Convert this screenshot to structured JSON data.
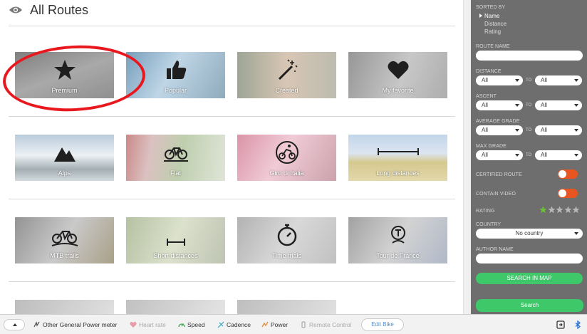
{
  "header": {
    "title": "All Routes"
  },
  "tiles": {
    "premium": "Premium",
    "popular": "Popular",
    "created": "Created",
    "favorite": "My favorite",
    "alps": "Alps",
    "flat": "Flat",
    "giro": "Giro di Italia",
    "long": "Long distances",
    "mtb": "MTB trails",
    "short": "Short distances",
    "time": "Time trials",
    "tdf": "Tour de France"
  },
  "sidebar": {
    "sorted_by": "SORTED BY",
    "sort_options": [
      "Name",
      "Distance",
      "Rating"
    ],
    "route_name": "ROUTE NAME",
    "distance": "DISTANCE",
    "ascent": "ASCENT",
    "average_grade": "AVERAGE GRADE",
    "max_grade": "MAX GRADE",
    "to": "TO",
    "all": "All",
    "certified_route": "CERTIFIED ROUTE",
    "contain_video": "CONTAIN VIDEO",
    "rating": "RATING",
    "rating_value": 1,
    "country": "COUNTRY",
    "country_value": "No country",
    "author_name": "AUTHOR NAME",
    "search_in_map": "SEARCH IN MAP",
    "search": "Search"
  },
  "bottombar": {
    "power_meter": "Other General Power meter",
    "heart_rate": "Heart rate",
    "speed": "Speed",
    "cadence": "Cadence",
    "power": "Power",
    "remote_control": "Remote Control",
    "edit_bike": "Edit Bike"
  },
  "colors": {
    "accent_red": "#e8181e",
    "toggle_orange": "#e95520",
    "green": "#3ec86a",
    "sidebar": "#6e6e6e"
  }
}
